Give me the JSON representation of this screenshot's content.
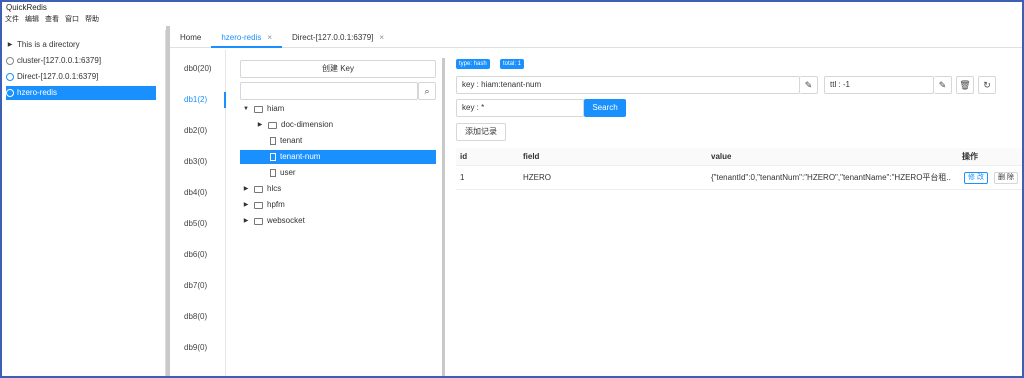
{
  "window": {
    "title": "QuickRedis"
  },
  "menu": [
    "文件",
    "编辑",
    "查看",
    "窗口",
    "帮助"
  ],
  "connections": [
    {
      "label": "This is a directory",
      "icon": "caret-right-icon"
    },
    {
      "label": "cluster-[127.0.0.1:6379]",
      "icon": "circle-icon"
    },
    {
      "label": "Direct-[127.0.0.1:6379]",
      "icon": "check-circle-icon"
    },
    {
      "label": "hzero-redis",
      "icon": "check-circle-icon"
    }
  ],
  "tabs": [
    {
      "label": "Home",
      "closable": false
    },
    {
      "label": "hzero-redis",
      "closable": true
    },
    {
      "label": "Direct-[127.0.0.1:6379]",
      "closable": true
    }
  ],
  "tab_close_glyph": "×",
  "databases": [
    "db0(20)",
    "db1(2)",
    "db2(0)",
    "db3(0)",
    "db4(0)",
    "db5(0)",
    "db6(0)",
    "db7(0)",
    "db8(0)",
    "db9(0)"
  ],
  "key_panel": {
    "create_label": "创建 Key",
    "search_placeholder": "",
    "tree": [
      {
        "label": "hiam",
        "type": "folder",
        "expanded": true,
        "depth": 0
      },
      {
        "label": "doc-dimension",
        "type": "folder",
        "expanded": false,
        "depth": 1
      },
      {
        "label": "tenant",
        "type": "key",
        "depth": 1
      },
      {
        "label": "tenant-num",
        "type": "key",
        "depth": 1
      },
      {
        "label": "user",
        "type": "key",
        "depth": 1
      },
      {
        "label": "hlcs",
        "type": "folder",
        "expanded": false,
        "depth": 0
      },
      {
        "label": "hpfm",
        "type": "folder",
        "expanded": false,
        "depth": 0
      },
      {
        "label": "websocket",
        "type": "folder",
        "expanded": false,
        "depth": 0
      }
    ]
  },
  "detail": {
    "type_tag": "type: hash",
    "total_tag": "total: 1",
    "key_value": "key : hiam:tenant-num",
    "ttl_value": "ttl : -1",
    "filter_value": "key : *",
    "search_label": "Search",
    "add_label": "添加记录",
    "columns": [
      "id",
      "field",
      "value",
      "操作"
    ],
    "rows": [
      {
        "id": "1",
        "field": "HZERO",
        "value": "{\"tenantId\":0,\"tenantNum\":\"HZERO\",\"tenantName\":\"HZERO平台租...",
        "edit": "修 改",
        "delete": "删 除"
      }
    ]
  },
  "accent": "#1a90ff",
  "border_color": "#3f5fb5"
}
